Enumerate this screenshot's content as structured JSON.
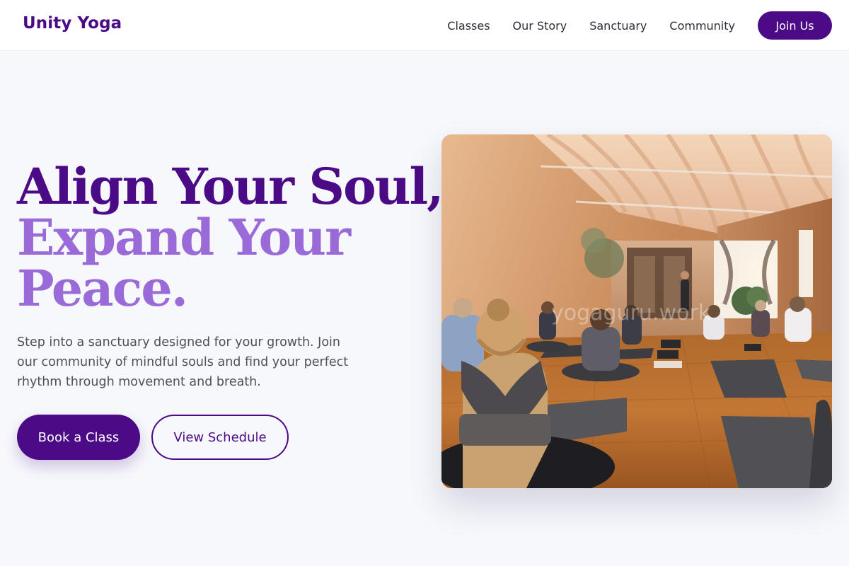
{
  "header": {
    "logo": "Unity Yoga",
    "nav": [
      "Classes",
      "Our Story",
      "Sanctuary",
      "Community"
    ],
    "cta": "Join Us"
  },
  "hero": {
    "headline_line1": "Align Your Soul,",
    "headline_line2a": "Expand Your",
    "headline_line2b": "Peace.",
    "subtitle": "Step into a sanctuary designed for your growth. Join our community of mindful souls and find your perfect rhythm through movement and breath.",
    "primary_button": "Book a Class",
    "secondary_button": "View Schedule",
    "image_watermark": "yogaguru.work"
  },
  "colors": {
    "brand": "#4b0a86",
    "accent": "#9b6ad9",
    "background": "#f7f8fc"
  }
}
